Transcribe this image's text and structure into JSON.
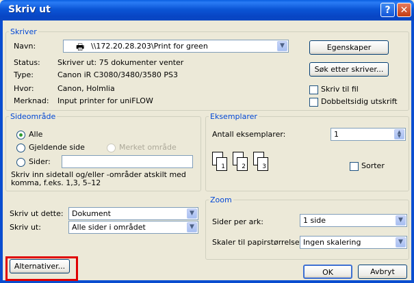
{
  "window": {
    "title": "Skriv ut",
    "help_glyph": "?",
    "close_glyph": "✕"
  },
  "printer": {
    "legend": "Skriver",
    "name_label": "Navn:",
    "name_value": "\\\\172.20.28.203\\Print for green",
    "properties_button": "Egenskaper",
    "status_label": "Status:",
    "status_value": "Skriver ut: 75 dokumenter venter",
    "type_label": "Type:",
    "type_value": "Canon iR C3080/3480/3580 PS3",
    "where_label": "Hvor:",
    "where_value": "Canon, Holmlia",
    "comment_label": "Merknad:",
    "comment_value": "Input printer for uniFLOW",
    "find_button": "Søk etter skriver...",
    "print_to_file": "Skriv til fil",
    "duplex": "Dobbeltsidig utskrift"
  },
  "range": {
    "legend": "Sideområde",
    "all": "Alle",
    "current": "Gjeldende side",
    "selection": "Merket område",
    "pages": "Sider:",
    "hint": "Skriv inn sidetall og/eller -områder atskilt med komma, f.eks. 1,3, 5–12"
  },
  "copies": {
    "legend": "Eksemplarer",
    "count_label": "Antall eksemplarer:",
    "count_value": "1",
    "collate": "Sorter",
    "pages": [
      "1",
      "1",
      "2",
      "2",
      "3",
      "3"
    ]
  },
  "print_what": {
    "label": "Skriv ut dette:",
    "value": "Dokument"
  },
  "print_sel": {
    "label": "Skriv ut:",
    "value": "Alle sider i området"
  },
  "zoom": {
    "legend": "Zoom",
    "pps_label": "Sider per ark:",
    "pps_value": "1 side",
    "scale_label": "Skaler til papirstørrelse:",
    "scale_value": "Ingen skalering"
  },
  "buttons": {
    "options": "Alternativer...",
    "ok": "OK",
    "cancel": "Avbryt"
  },
  "icons": {
    "arrow": "▼",
    "spin_up": "▲",
    "spin_down": "▼"
  }
}
